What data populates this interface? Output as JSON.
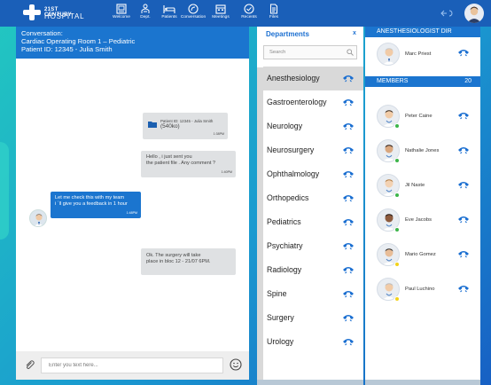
{
  "app": {
    "logo_line1": "21ST CENTURY",
    "logo_line2": "HOSPITAL"
  },
  "nav": [
    {
      "label": "Welcome",
      "icon": "welcome-icon"
    },
    {
      "label": "Dept.",
      "icon": "dept-icon"
    },
    {
      "label": "Patients",
      "icon": "bed-icon"
    },
    {
      "label": "Conversation",
      "icon": "chat-icon"
    },
    {
      "label": "Meetings",
      "icon": "calendar-icon"
    },
    {
      "label": "Recents",
      "icon": "clock-check-icon"
    },
    {
      "label": "Files",
      "icon": "file-icon"
    }
  ],
  "conversation": {
    "title": "Conversation:",
    "room": "Cardiac Operating Room 1 – Pediatric",
    "patient": "Patient ID: 12345 - Julia Smith",
    "messages": [
      {
        "file_name": "Patient ID: 12345 - Julia Smith",
        "file_size": "(540ko)",
        "time": "1:38PM"
      },
      {
        "text_line1": "Hello , i just sent you",
        "text_line2": "the patient file . Any comment ?",
        "time": "1:40PM"
      },
      {
        "text_line1": "Let me check this with my team",
        "text_line2": "i ´ll give you a feedback in 1 hour",
        "time": "1:48PM"
      },
      {
        "text_line1": "Ok.  The surgery  will take",
        "text_line2": "place in bloc 12 - 21/07 6PM."
      }
    ],
    "composer_placeholder": "Enter you text here..."
  },
  "departments": {
    "title": "Departments",
    "close": "x",
    "search_placeholder": "Search",
    "active_index": 0,
    "items": [
      "Anesthesiology",
      "Gastroenterology",
      "Neurology",
      "Neurosurgery",
      "Ophthalmology",
      "Orthopedics",
      "Pediatrics",
      "Psychiatry",
      "Radiology",
      "Spine",
      "Surgery",
      "Urology"
    ]
  },
  "directory": {
    "director_title": "ANESTHESIOLOGIST DIR",
    "director": {
      "name": "Marc Priest"
    },
    "members_title": "MEMBERS",
    "members_count": "20",
    "members": [
      {
        "name": "Peter Caine",
        "status": "online"
      },
      {
        "name": "Nathalie Jones",
        "status": "online"
      },
      {
        "name": "Jil Naste",
        "status": "online"
      },
      {
        "name": "Eve Jacobs",
        "status": "online"
      },
      {
        "name": "Mario Gomez",
        "status": "away"
      },
      {
        "name": "Paul Luchino",
        "status": "away"
      }
    ]
  },
  "colors": {
    "primary": "#1b75cf",
    "nav": "#1a5fb8",
    "online": "#3db54a",
    "away": "#f2d21b"
  }
}
